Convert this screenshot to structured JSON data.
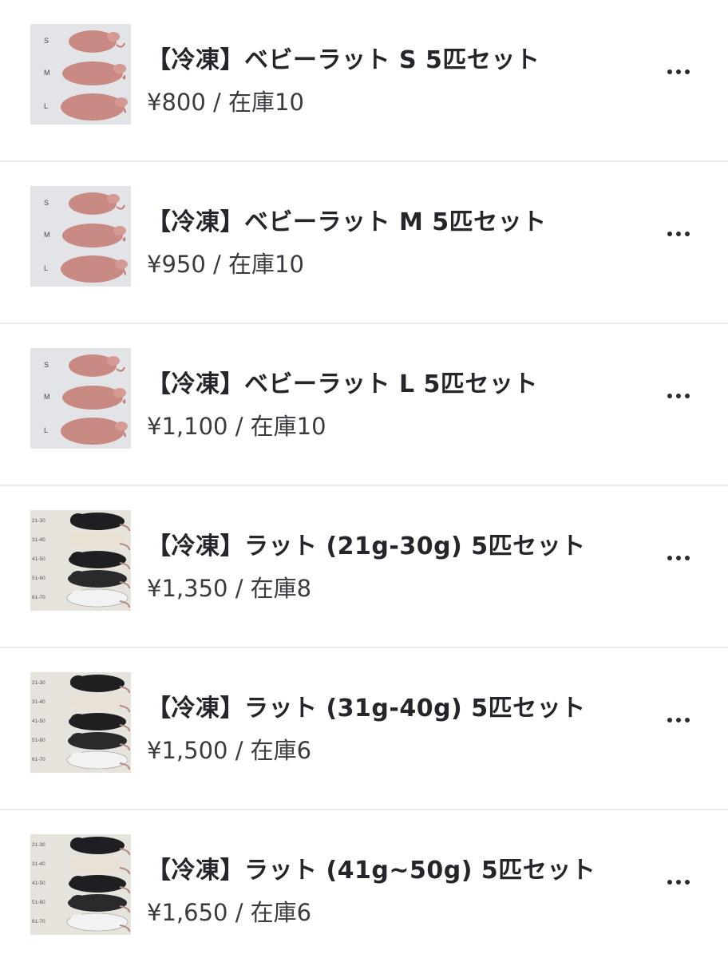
{
  "products": [
    {
      "title": "【冷凍】ベビーラット S 5匹セット",
      "price": "¥800 / 在庫10",
      "image_kind": "baby",
      "image_labels": [
        "S",
        "M",
        "L"
      ]
    },
    {
      "title": "【冷凍】ベビーラット M 5匹セット",
      "price": "¥950 / 在庫10",
      "image_kind": "baby",
      "image_labels": [
        "S",
        "M",
        "L"
      ]
    },
    {
      "title": "【冷凍】ベビーラット L 5匹セット",
      "price": "¥1,100 / 在庫10",
      "image_kind": "baby",
      "image_labels": [
        "S",
        "M",
        "L"
      ]
    },
    {
      "title": "【冷凍】ラット (21g-30g) 5匹セット",
      "price": "¥1,350 / 在庫8",
      "image_kind": "adult",
      "image_labels": [
        "21-30",
        "31-40",
        "41-50",
        "51-60",
        "61-70"
      ]
    },
    {
      "title": "【冷凍】ラット (31g-40g) 5匹セット",
      "price": "¥1,500 / 在庫6",
      "image_kind": "adult",
      "image_labels": [
        "21-30",
        "31-40",
        "41-50",
        "51-60",
        "61-70"
      ]
    },
    {
      "title": "【冷凍】ラット (41g~50g) 5匹セット",
      "price": "¥1,650 / 在庫6",
      "image_kind": "adult",
      "image_labels": [
        "21-30",
        "31-40",
        "41-50",
        "51-60",
        "61-70"
      ]
    }
  ],
  "icons": {
    "more": "more-horizontal-icon"
  },
  "colors": {
    "title": "#25262b",
    "price": "#3a3b40",
    "divider": "#ececf0",
    "baby_rat": "#c98a84",
    "adult_rat_dark": "#1f1f22",
    "adult_rat_light": "#e9e1d3"
  }
}
